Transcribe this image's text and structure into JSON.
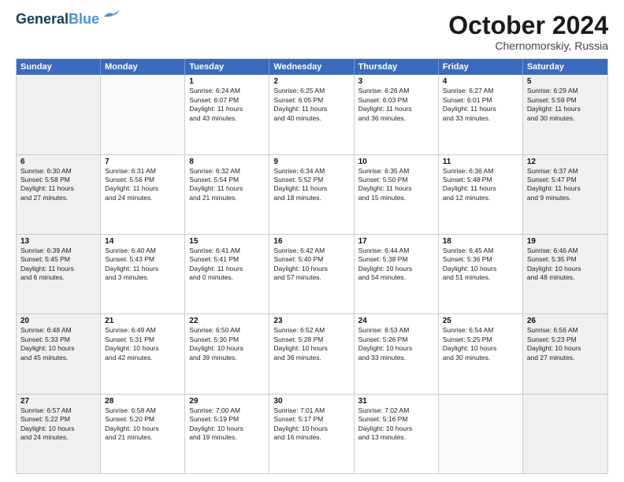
{
  "header": {
    "logo_line1": "General",
    "logo_line2": "Blue",
    "month": "October 2024",
    "location": "Chernomorskiy, Russia"
  },
  "days_of_week": [
    "Sunday",
    "Monday",
    "Tuesday",
    "Wednesday",
    "Thursday",
    "Friday",
    "Saturday"
  ],
  "rows": [
    [
      {
        "day": "",
        "info": [],
        "empty": true
      },
      {
        "day": "",
        "info": [],
        "empty": true
      },
      {
        "day": "1",
        "info": [
          "Sunrise: 6:24 AM",
          "Sunset: 6:07 PM",
          "Daylight: 11 hours",
          "and 43 minutes."
        ]
      },
      {
        "day": "2",
        "info": [
          "Sunrise: 6:25 AM",
          "Sunset: 6:05 PM",
          "Daylight: 11 hours",
          "and 40 minutes."
        ]
      },
      {
        "day": "3",
        "info": [
          "Sunrise: 6:26 AM",
          "Sunset: 6:03 PM",
          "Daylight: 11 hours",
          "and 36 minutes."
        ]
      },
      {
        "day": "4",
        "info": [
          "Sunrise: 6:27 AM",
          "Sunset: 6:01 PM",
          "Daylight: 11 hours",
          "and 33 minutes."
        ]
      },
      {
        "day": "5",
        "info": [
          "Sunrise: 6:29 AM",
          "Sunset: 5:59 PM",
          "Daylight: 11 hours",
          "and 30 minutes."
        ]
      }
    ],
    [
      {
        "day": "6",
        "info": [
          "Sunrise: 6:30 AM",
          "Sunset: 5:58 PM",
          "Daylight: 11 hours",
          "and 27 minutes."
        ]
      },
      {
        "day": "7",
        "info": [
          "Sunrise: 6:31 AM",
          "Sunset: 5:56 PM",
          "Daylight: 11 hours",
          "and 24 minutes."
        ]
      },
      {
        "day": "8",
        "info": [
          "Sunrise: 6:32 AM",
          "Sunset: 5:54 PM",
          "Daylight: 11 hours",
          "and 21 minutes."
        ]
      },
      {
        "day": "9",
        "info": [
          "Sunrise: 6:34 AM",
          "Sunset: 5:52 PM",
          "Daylight: 11 hours",
          "and 18 minutes."
        ]
      },
      {
        "day": "10",
        "info": [
          "Sunrise: 6:35 AM",
          "Sunset: 5:50 PM",
          "Daylight: 11 hours",
          "and 15 minutes."
        ]
      },
      {
        "day": "11",
        "info": [
          "Sunrise: 6:36 AM",
          "Sunset: 5:48 PM",
          "Daylight: 11 hours",
          "and 12 minutes."
        ]
      },
      {
        "day": "12",
        "info": [
          "Sunrise: 6:37 AM",
          "Sunset: 5:47 PM",
          "Daylight: 11 hours",
          "and 9 minutes."
        ]
      }
    ],
    [
      {
        "day": "13",
        "info": [
          "Sunrise: 6:39 AM",
          "Sunset: 5:45 PM",
          "Daylight: 11 hours",
          "and 6 minutes."
        ]
      },
      {
        "day": "14",
        "info": [
          "Sunrise: 6:40 AM",
          "Sunset: 5:43 PM",
          "Daylight: 11 hours",
          "and 3 minutes."
        ]
      },
      {
        "day": "15",
        "info": [
          "Sunrise: 6:41 AM",
          "Sunset: 5:41 PM",
          "Daylight: 11 hours",
          "and 0 minutes."
        ]
      },
      {
        "day": "16",
        "info": [
          "Sunrise: 6:42 AM",
          "Sunset: 5:40 PM",
          "Daylight: 10 hours",
          "and 57 minutes."
        ]
      },
      {
        "day": "17",
        "info": [
          "Sunrise: 6:44 AM",
          "Sunset: 5:38 PM",
          "Daylight: 10 hours",
          "and 54 minutes."
        ]
      },
      {
        "day": "18",
        "info": [
          "Sunrise: 6:45 AM",
          "Sunset: 5:36 PM",
          "Daylight: 10 hours",
          "and 51 minutes."
        ]
      },
      {
        "day": "19",
        "info": [
          "Sunrise: 6:46 AM",
          "Sunset: 5:35 PM",
          "Daylight: 10 hours",
          "and 48 minutes."
        ]
      }
    ],
    [
      {
        "day": "20",
        "info": [
          "Sunrise: 6:48 AM",
          "Sunset: 5:33 PM",
          "Daylight: 10 hours",
          "and 45 minutes."
        ]
      },
      {
        "day": "21",
        "info": [
          "Sunrise: 6:49 AM",
          "Sunset: 5:31 PM",
          "Daylight: 10 hours",
          "and 42 minutes."
        ]
      },
      {
        "day": "22",
        "info": [
          "Sunrise: 6:50 AM",
          "Sunset: 5:30 PM",
          "Daylight: 10 hours",
          "and 39 minutes."
        ]
      },
      {
        "day": "23",
        "info": [
          "Sunrise: 6:52 AM",
          "Sunset: 5:28 PM",
          "Daylight: 10 hours",
          "and 36 minutes."
        ]
      },
      {
        "day": "24",
        "info": [
          "Sunrise: 6:53 AM",
          "Sunset: 5:26 PM",
          "Daylight: 10 hours",
          "and 33 minutes."
        ]
      },
      {
        "day": "25",
        "info": [
          "Sunrise: 6:54 AM",
          "Sunset: 5:25 PM",
          "Daylight: 10 hours",
          "and 30 minutes."
        ]
      },
      {
        "day": "26",
        "info": [
          "Sunrise: 6:56 AM",
          "Sunset: 5:23 PM",
          "Daylight: 10 hours",
          "and 27 minutes."
        ]
      }
    ],
    [
      {
        "day": "27",
        "info": [
          "Sunrise: 6:57 AM",
          "Sunset: 5:22 PM",
          "Daylight: 10 hours",
          "and 24 minutes."
        ]
      },
      {
        "day": "28",
        "info": [
          "Sunrise: 6:58 AM",
          "Sunset: 5:20 PM",
          "Daylight: 10 hours",
          "and 21 minutes."
        ]
      },
      {
        "day": "29",
        "info": [
          "Sunrise: 7:00 AM",
          "Sunset: 5:19 PM",
          "Daylight: 10 hours",
          "and 19 minutes."
        ]
      },
      {
        "day": "30",
        "info": [
          "Sunrise: 7:01 AM",
          "Sunset: 5:17 PM",
          "Daylight: 10 hours",
          "and 16 minutes."
        ]
      },
      {
        "day": "31",
        "info": [
          "Sunrise: 7:02 AM",
          "Sunset: 5:16 PM",
          "Daylight: 10 hours",
          "and 13 minutes."
        ]
      },
      {
        "day": "",
        "info": [],
        "empty": true
      },
      {
        "day": "",
        "info": [],
        "empty": true
      }
    ]
  ]
}
